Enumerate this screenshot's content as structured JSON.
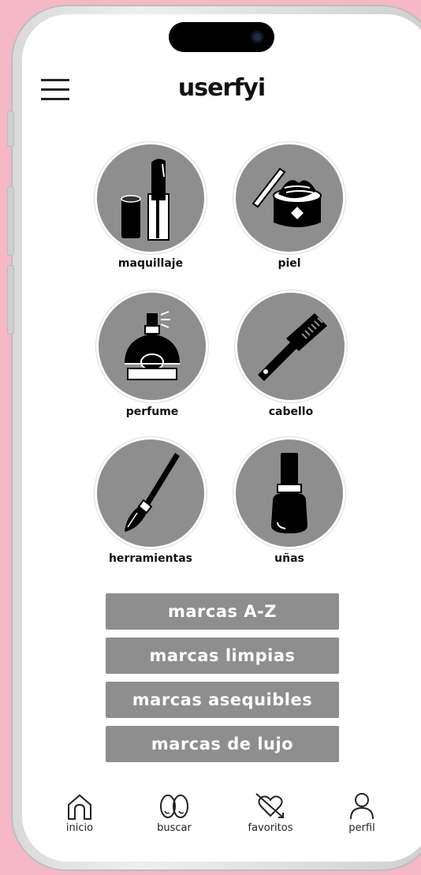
{
  "app": {
    "logo_text": "userfyi"
  },
  "categories": [
    {
      "label": "maquillaje",
      "icon": "lipstick-icon"
    },
    {
      "label": "piel",
      "icon": "cream-jar-icon"
    },
    {
      "label": "perfume",
      "icon": "perfume-bottle-icon"
    },
    {
      "label": "cabello",
      "icon": "comb-icon"
    },
    {
      "label": "herramientas",
      "icon": "makeup-brush-icon"
    },
    {
      "label": "uñas",
      "icon": "nail-polish-icon"
    }
  ],
  "brand_buttons": [
    {
      "label": "marcas A-Z"
    },
    {
      "label": "marcas limpias"
    },
    {
      "label": "marcas asequibles"
    },
    {
      "label": "marcas de lujo"
    }
  ],
  "bottom_nav": [
    {
      "label": "inicio",
      "icon": "home-icon"
    },
    {
      "label": "buscar",
      "icon": "search-icon"
    },
    {
      "label": "favoritos",
      "icon": "heart-arrow-icon"
    },
    {
      "label": "perfil",
      "icon": "user-icon"
    }
  ],
  "colors": {
    "background": "#f6b8c6",
    "accent_gray": "#8e8e8e"
  }
}
